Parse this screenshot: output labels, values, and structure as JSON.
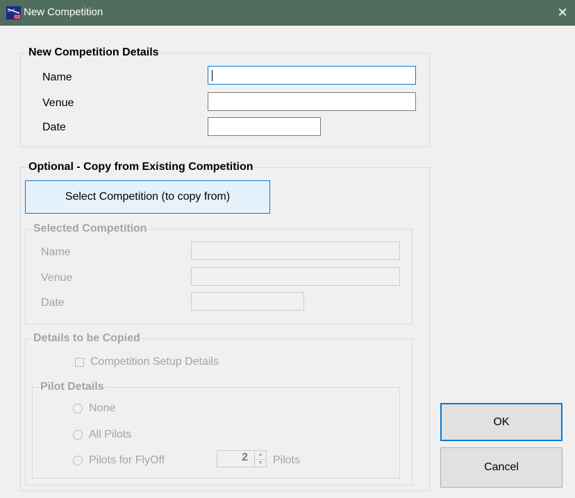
{
  "window": {
    "title": "New Competition",
    "close_glyph": "✕"
  },
  "details": {
    "legend": "New Competition Details",
    "name_label": "Name",
    "name_value": "",
    "venue_label": "Venue",
    "venue_value": "",
    "date_label": "Date",
    "date_value": ""
  },
  "copy": {
    "legend": "Optional - Copy from Existing Competition",
    "select_button": "Select Competition (to copy from)",
    "selected": {
      "legend": "Selected Competition",
      "name_label": "Name",
      "venue_label": "Venue",
      "date_label": "Date",
      "name_value": "",
      "venue_value": "",
      "date_value": ""
    },
    "to_copy": {
      "legend": "Details to be Copied",
      "setup_checkbox_label": "Competition Setup Details",
      "setup_checked": false,
      "pilot": {
        "legend": "Pilot Details",
        "none_label": "None",
        "all_label": "All Pilots",
        "flyoff_label": "Pilots for FlyOff",
        "flyoff_count": "2",
        "pilots_suffix": "Pilots"
      }
    }
  },
  "buttons": {
    "ok": "OK",
    "cancel": "Cancel"
  },
  "icons": {
    "up": "▲",
    "down": "▼"
  },
  "colors": {
    "titlebar": "#4f6e5e",
    "focus": "#0078d7",
    "background": "#f0f0f0"
  }
}
